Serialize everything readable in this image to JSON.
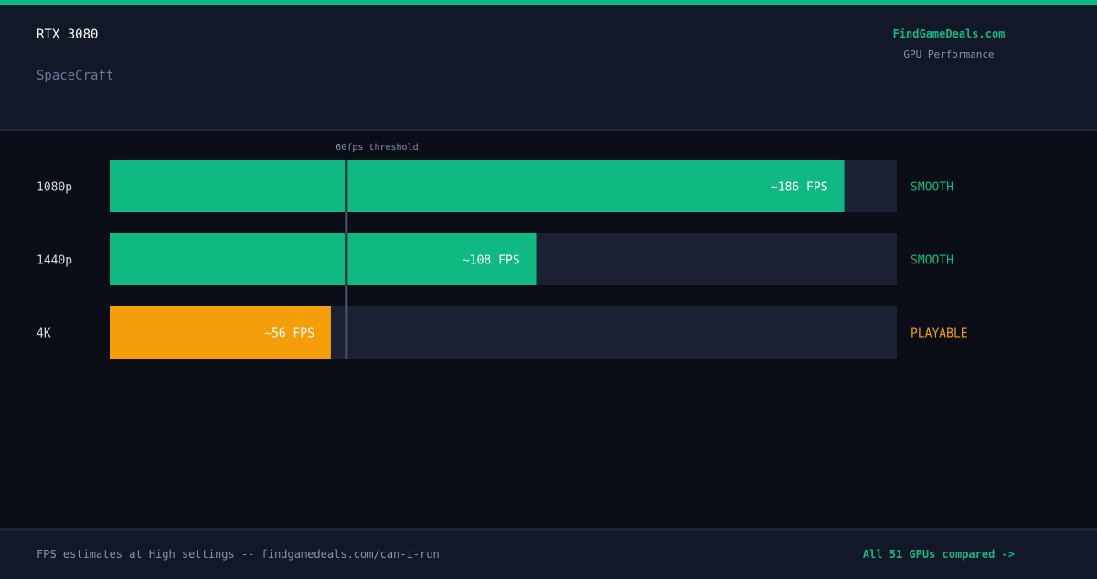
{
  "header": {
    "gpu": "RTX 3080",
    "game": "SpaceCraft",
    "brand": "FindGameDeals.com",
    "brand_sub": "GPU Performance"
  },
  "colors": {
    "smooth": "#10b981",
    "playable": "#f59e0b",
    "track": "#1a2133",
    "threshold": "#4a5468"
  },
  "chart_data": {
    "type": "bar",
    "orientation": "horizontal",
    "categories": [
      "1080p",
      "1440p",
      "4K"
    ],
    "values": [
      186,
      108,
      56
    ],
    "value_labels": [
      "~186 FPS",
      "~108 FPS",
      "~56 FPS"
    ],
    "ratings": [
      "SMOOTH",
      "SMOOTH",
      "PLAYABLE"
    ],
    "bar_colors": [
      "#10b981",
      "#10b981",
      "#f59e0b"
    ],
    "rating_colors": [
      "#10b981",
      "#10b981",
      "#f59e0b"
    ],
    "xlim": [
      0,
      200
    ],
    "threshold": {
      "value": 60,
      "label": "60fps threshold"
    },
    "grid": false
  },
  "footer": {
    "note": "FPS estimates at High settings -- findgamedeals.com/can-i-run",
    "link": "All 51 GPUs compared ->"
  }
}
